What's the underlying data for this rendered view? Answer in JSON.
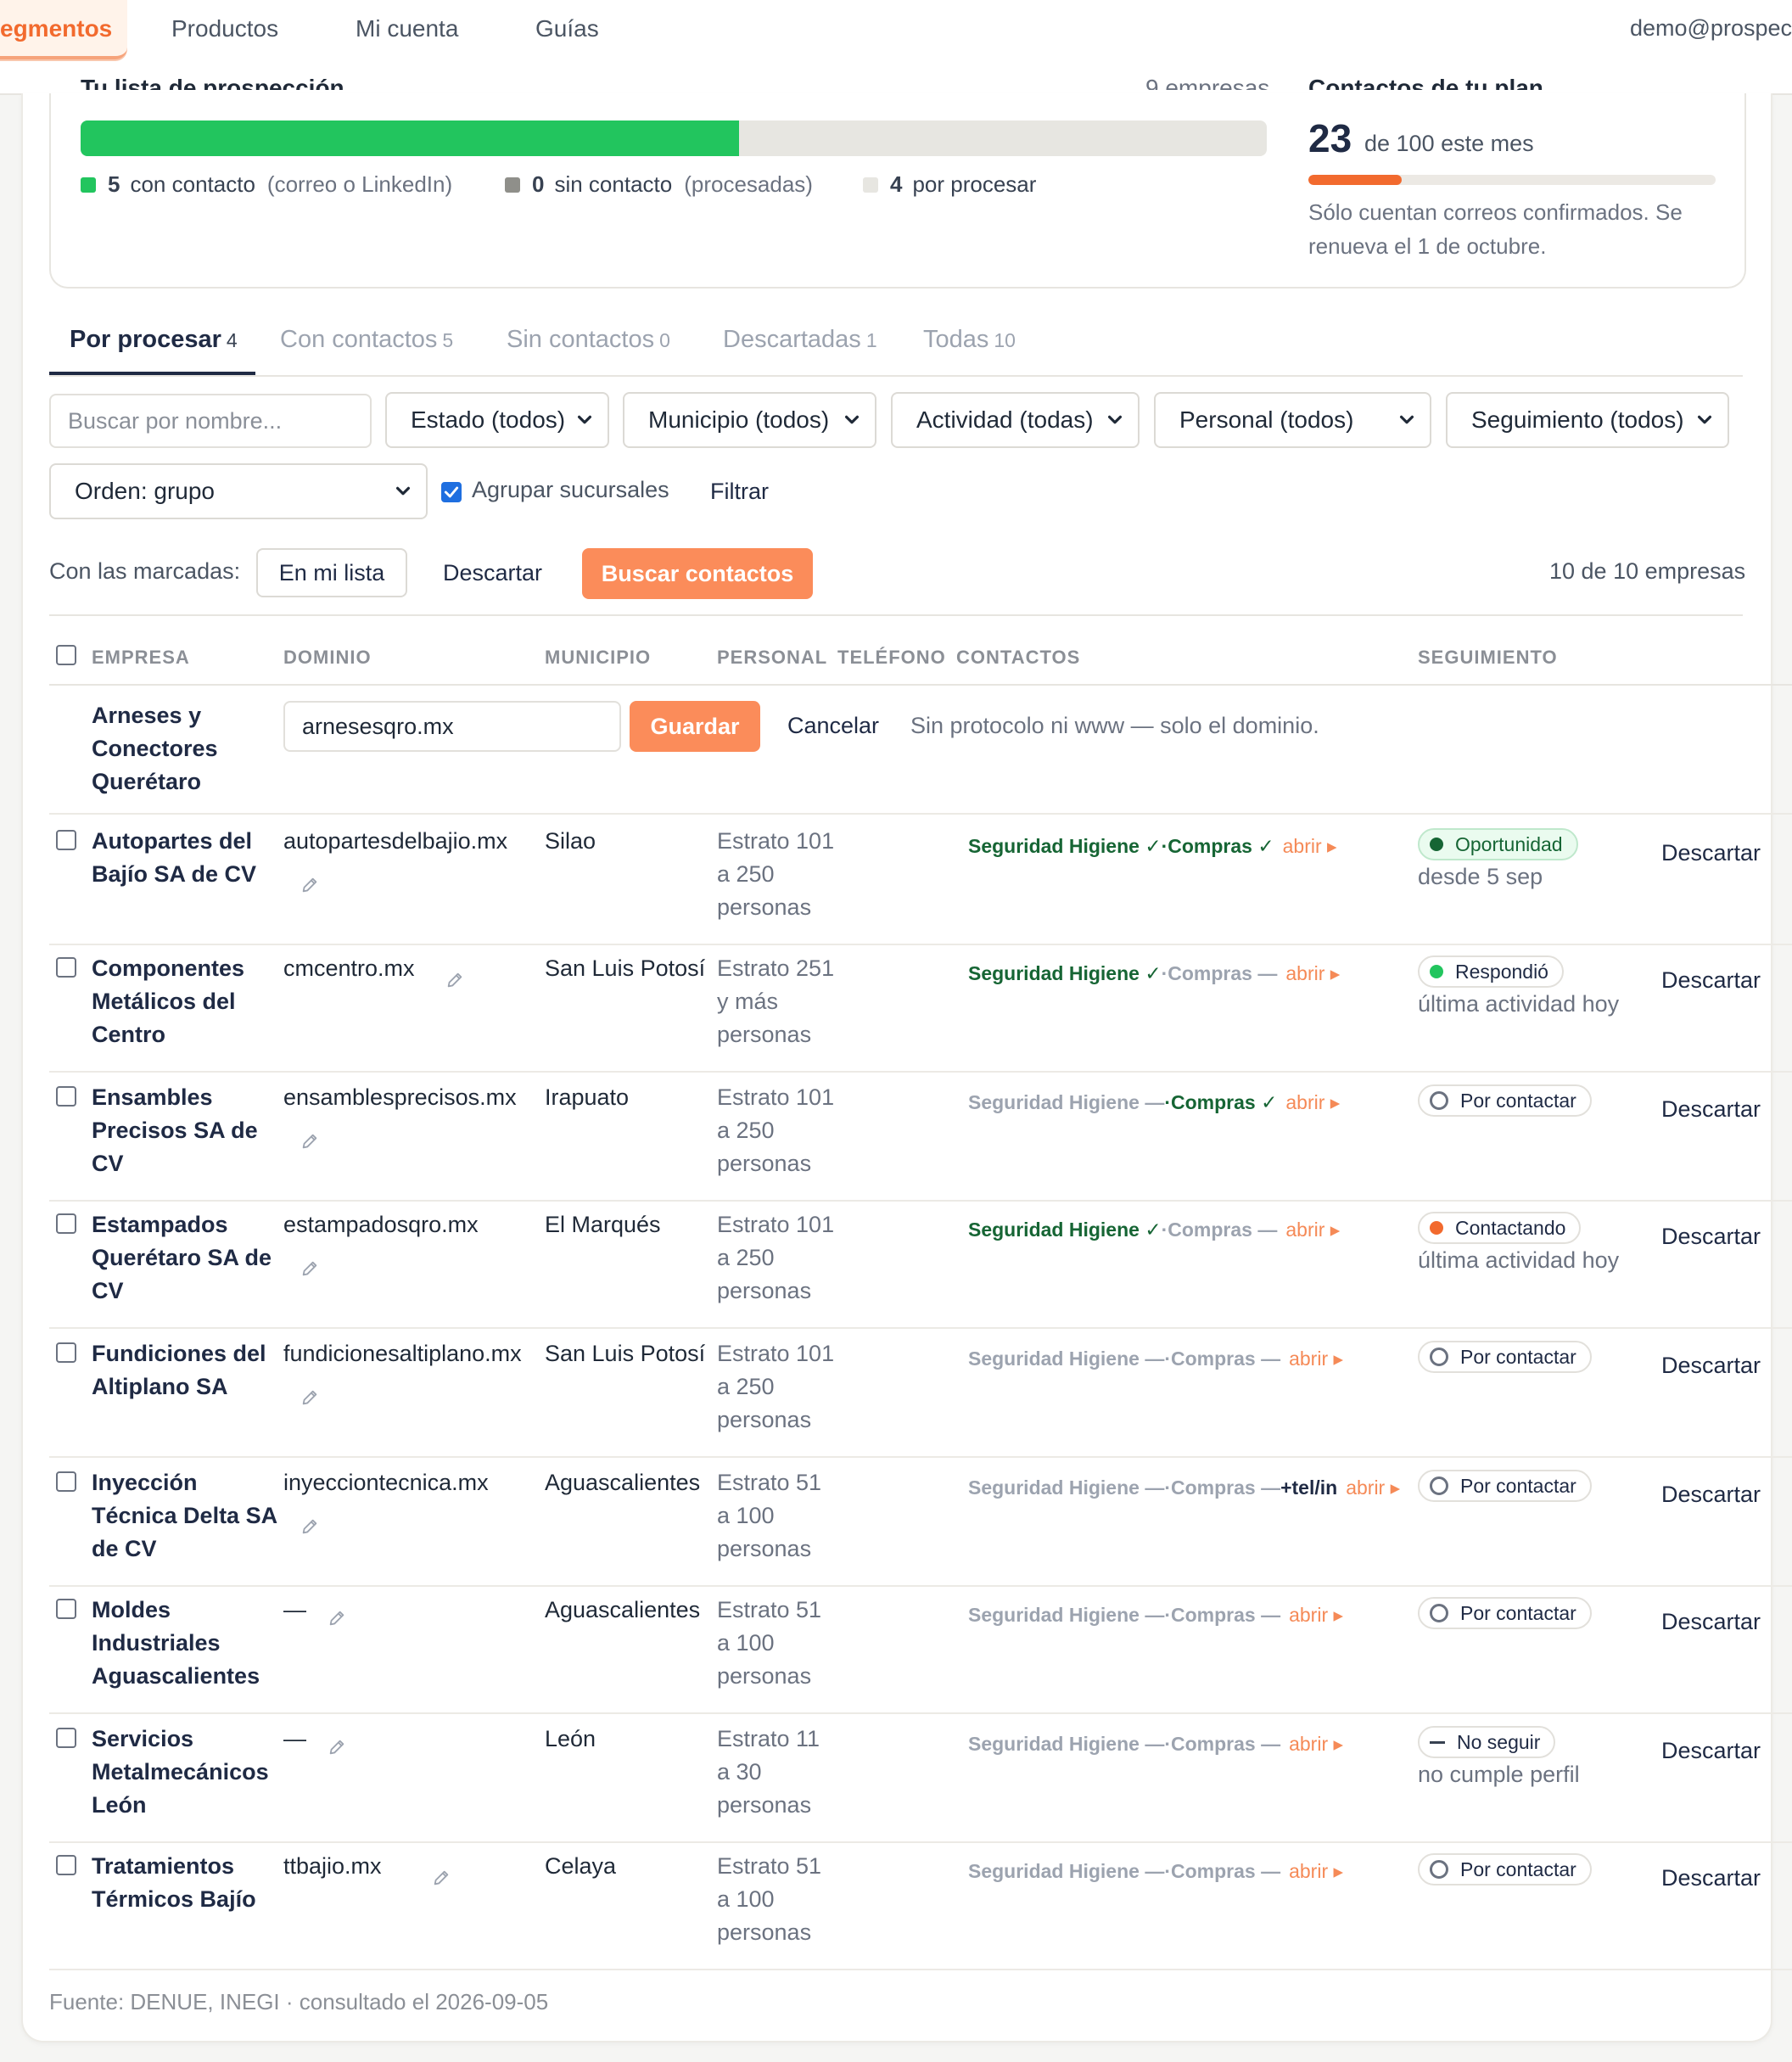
{
  "nav": {
    "tabs": [
      "egmentos",
      "Productos",
      "Mi cuenta",
      "Guías"
    ],
    "user": "demo@prospec"
  },
  "summary": {
    "title_clipped": "Tu lista de prospección",
    "count_clipped": "9 empresas",
    "progress_fraction": 0.555,
    "legend": [
      {
        "num": "5",
        "label": "con contacto",
        "hint": "(correo o LinkedIn)",
        "color": "#22c55e"
      },
      {
        "num": "0",
        "label": "sin contacto",
        "hint": "(procesadas)",
        "color": "#8f8f8a"
      },
      {
        "num": "4",
        "label": "por procesar",
        "hint": "",
        "color": "#e7e6e1"
      }
    ],
    "plan": {
      "title_clipped": "Contactos de tu plan",
      "used": "23",
      "of_text": "de 100 este mes",
      "used_fraction": 0.23,
      "note": "Sólo cuentan correos confirmados. Se renueva el 1 de octubre."
    }
  },
  "tabs": [
    {
      "label": "Por procesar",
      "count": "4"
    },
    {
      "label": "Con contactos",
      "count": "5"
    },
    {
      "label": "Sin contactos",
      "count": "0"
    },
    {
      "label": "Descartadas",
      "count": "1"
    },
    {
      "label": "Todas",
      "count": "10"
    }
  ],
  "filters": {
    "search_placeholder": "Buscar por nombre...",
    "estado": "Estado (todos)",
    "municipio": "Municipio (todos)",
    "actividad": "Actividad (todas)",
    "personal": "Personal (todos)",
    "seguimiento": "Seguimiento (todos)",
    "orden": "Orden: grupo",
    "agrupar_label": "Agrupar sucursales",
    "agrupar_checked": true,
    "filtrar": "Filtrar"
  },
  "bulk": {
    "label": "Con las marcadas:",
    "en_mi_lista": "En mi lista",
    "descartar": "Descartar",
    "buscar": "Buscar contactos",
    "count": "10 de 10 empresas"
  },
  "table": {
    "headers": [
      "EMPRESA",
      "DOMINIO",
      "MUNICIPIO",
      "PERSONAL",
      "TELÉFONO",
      "CONTACTOS",
      "SEGUIMIENTO"
    ],
    "editing": {
      "company": "Arneses y Conectores Querétaro",
      "domain_value": "arnesesqro.mx",
      "save": "Guardar",
      "cancel": "Cancelar",
      "hint": "Sin protocolo ni www — solo el dominio."
    },
    "rows": [
      {
        "company": "Autopartes del Bajío SA de CV",
        "domain": "autopartesdelbajio.mx",
        "municipio": "Silao",
        "personal": "Estrato 101 a 250 personas",
        "seg": "Seguridad Higiene ✓",
        "comp": "Compras ✓",
        "tel": "",
        "open": "abrir ▸",
        "status": "Oportunidad",
        "status_sub": "desde 5 sep",
        "discard": "Descartar"
      },
      {
        "company": "Componentes Metálicos del Centro",
        "domain": "cmcentro.mx",
        "municipio": "San Luis Potosí",
        "personal": "Estrato 251 y más personas",
        "seg": "Seguridad Higiene ✓",
        "comp": "Compras —",
        "tel": "",
        "open": "abrir ▸",
        "status": "Respondió",
        "status_sub": "última actividad hoy",
        "discard": "Descartar"
      },
      {
        "company": "Ensambles Precisos SA de CV",
        "domain": "ensamblesprecisos.mx",
        "municipio": "Irapuato",
        "personal": "Estrato 101 a 250 personas",
        "seg": "Seguridad Higiene —",
        "comp": "Compras ✓",
        "tel": "",
        "open": "abrir ▸",
        "status": "Por contactar",
        "status_sub": "",
        "discard": "Descartar"
      },
      {
        "company": "Estampados Querétaro SA de CV",
        "domain": "estampadosqro.mx",
        "municipio": "El Marqués",
        "personal": "Estrato 101 a 250 personas",
        "seg": "Seguridad Higiene ✓",
        "comp": "Compras —",
        "tel": "",
        "open": "abrir ▸",
        "status": "Contactando",
        "status_sub": "última actividad hoy",
        "discard": "Descartar"
      },
      {
        "company": "Fundiciones del Altiplano SA",
        "domain": "fundicionesaltiplano.mx",
        "municipio": "San Luis Potosí",
        "personal": "Estrato 101 a 250 personas",
        "seg": "Seguridad Higiene —",
        "comp": "Compras —",
        "tel": "",
        "open": "abrir ▸",
        "status": "Por contactar",
        "status_sub": "",
        "discard": "Descartar"
      },
      {
        "company": "Inyección Técnica Delta SA de CV",
        "domain": "inyecciontecnica.mx",
        "municipio": "Aguascalientes",
        "personal": "Estrato 51 a 100 personas",
        "seg": "Seguridad Higiene —",
        "comp": "Compras —",
        "tel": "+tel/in",
        "open": "abrir ▸",
        "status": "Por contactar",
        "status_sub": "",
        "discard": "Descartar"
      },
      {
        "company": "Moldes Industriales Aguascalientes",
        "domain": "—",
        "municipio": "Aguascalientes",
        "personal": "Estrato 51 a 100 personas",
        "seg": "Seguridad Higiene —",
        "comp": "Compras —",
        "tel": "",
        "open": "abrir ▸",
        "status": "Por contactar",
        "status_sub": "",
        "discard": "Descartar"
      },
      {
        "company": "Servicios Metalmecánicos León",
        "domain": "—",
        "municipio": "León",
        "personal": "Estrato 11 a 30 personas",
        "seg": "Seguridad Higiene —",
        "comp": "Compras —",
        "tel": "",
        "open": "abrir ▸",
        "status": "No seguir",
        "status_sub": "no cumple perfil",
        "discard": "Descartar"
      },
      {
        "company": "Tratamientos Térmicos Bajío",
        "domain": "ttbajio.mx",
        "municipio": "Celaya",
        "personal": "Estrato 51 a 100 personas",
        "seg": "Seguridad Higiene —",
        "comp": "Compras —",
        "tel": "",
        "open": "abrir ▸",
        "status": "Por contactar",
        "status_sub": "",
        "discard": "Descartar"
      }
    ]
  },
  "footer": "Fuente: DENUE, INEGI · consultado el 2026-09-05",
  "colors": {
    "accent": "#f26a2e",
    "button_orange": "#fb8c5a",
    "green": "#22c55e",
    "dark_green": "#166534",
    "navy": "#1f2a44"
  }
}
